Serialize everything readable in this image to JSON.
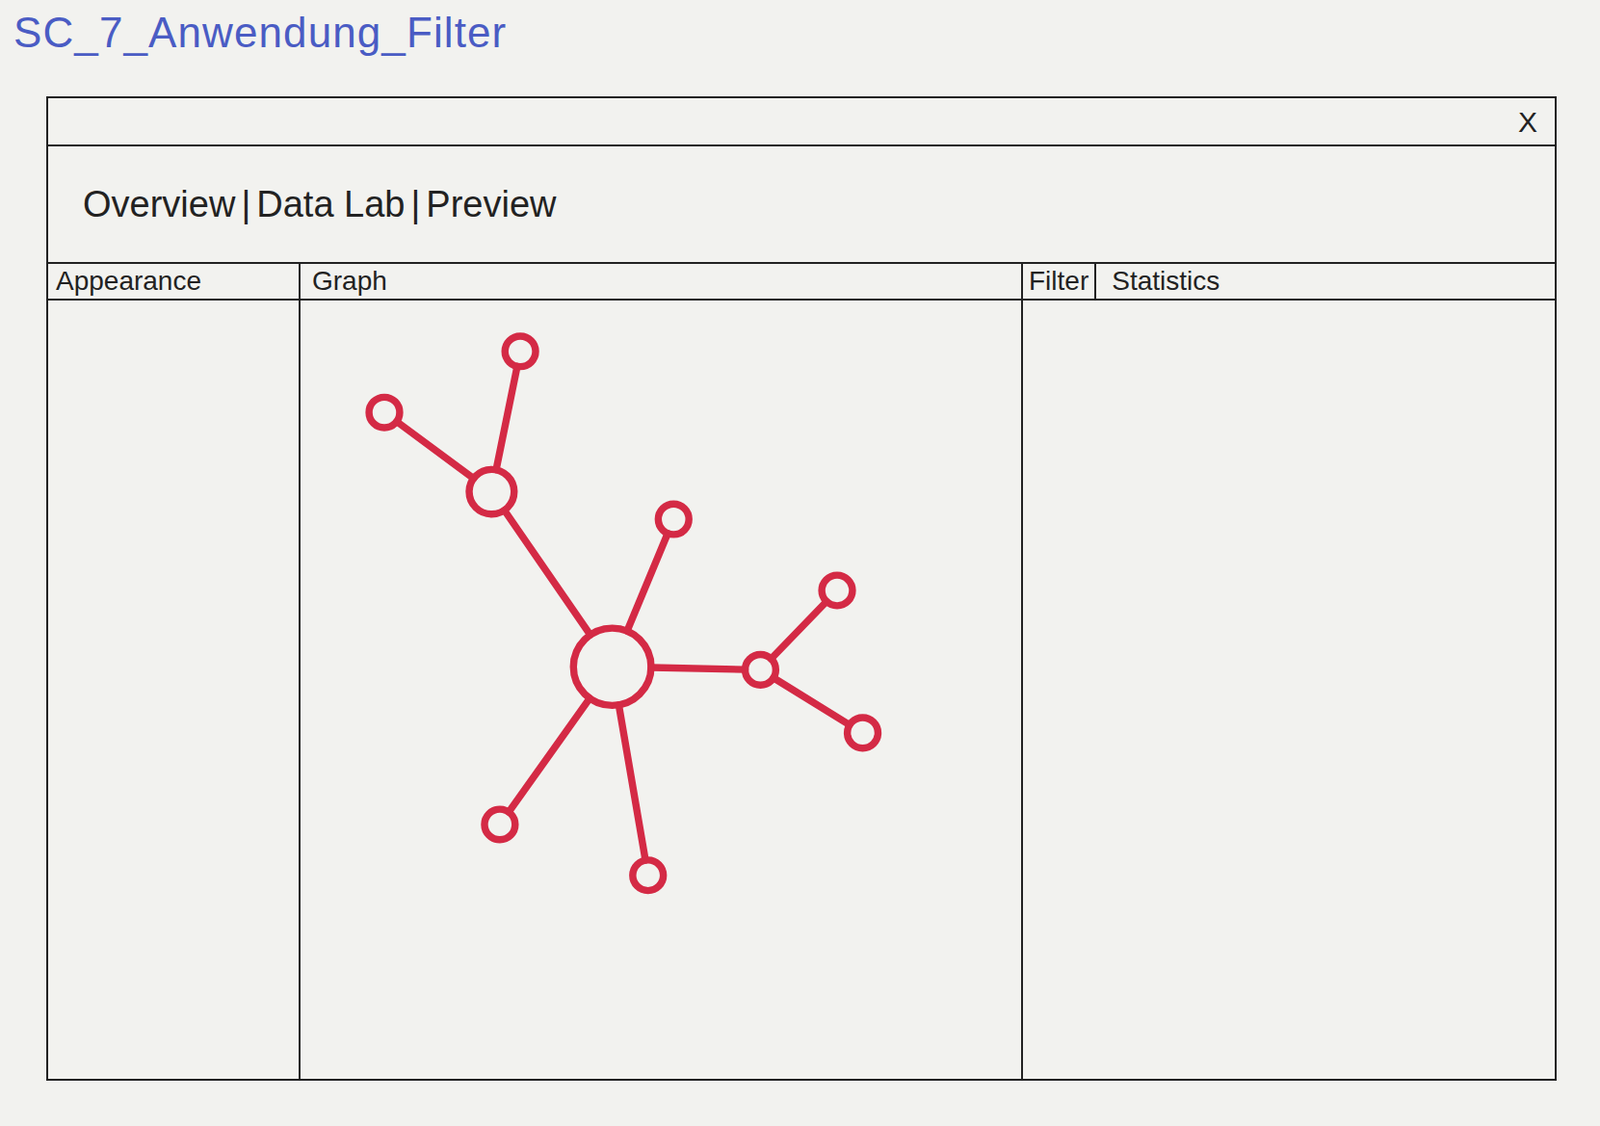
{
  "sheet": {
    "title": "SC_7_Anwendung_Filter"
  },
  "window": {
    "close": "X"
  },
  "tabs": [
    {
      "label": "Overview"
    },
    {
      "label": "Data Lab"
    },
    {
      "label": "Preview"
    }
  ],
  "tab_separator": "|",
  "panels": {
    "left": {
      "title": "Appearance"
    },
    "center": {
      "title": "Graph"
    },
    "right": {
      "tabs": [
        {
          "label": "Filter"
        },
        {
          "label": "Statistics"
        }
      ]
    }
  },
  "graph": {
    "color": "#d42a45",
    "nodes": [
      {
        "size": "large"
      },
      {
        "size": "medium"
      },
      {
        "size": "small"
      },
      {
        "size": "small"
      },
      {
        "size": "small"
      },
      {
        "size": "small"
      },
      {
        "size": "small"
      },
      {
        "size": "small"
      },
      {
        "size": "small"
      },
      {
        "size": "small"
      }
    ],
    "edges": [
      [
        0,
        1
      ],
      [
        1,
        2
      ],
      [
        1,
        3
      ],
      [
        0,
        4
      ],
      [
        0,
        5
      ],
      [
        5,
        6
      ],
      [
        5,
        7
      ],
      [
        0,
        8
      ],
      [
        0,
        9
      ]
    ]
  }
}
